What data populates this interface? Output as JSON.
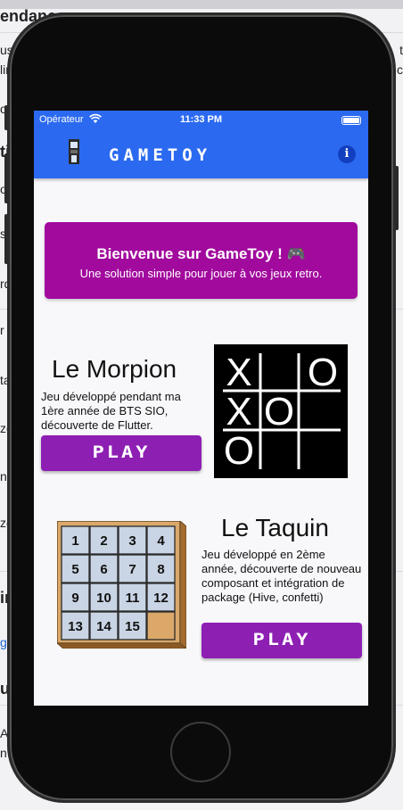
{
  "background": {
    "fragments": [
      "endances",
      "us",
      "lin",
      "o",
      "ti",
      "or",
      "s t",
      "rd",
      "r f",
      "ta",
      "ze",
      "no",
      "ze",
      "ir",
      "gi",
      "u",
      "Ax",
      "n"
    ],
    "right_fragments": [
      "t",
      "c"
    ]
  },
  "status_bar": {
    "carrier": "Opérateur",
    "time": "11:33 PM"
  },
  "app_bar": {
    "title": "GAMETOY"
  },
  "welcome": {
    "title": "Bienvenue sur GameToy ! 🎮",
    "subtitle": "Une solution simple pour jouer à vos jeux retro."
  },
  "games": [
    {
      "title": "Le Morpion",
      "description": "Jeu développé pendant ma 1ère année de BTS SIO, découverte de Flutter.",
      "play_label": "PLAY",
      "board": [
        "X",
        "",
        "O",
        "X",
        "O",
        "",
        "O",
        "",
        ""
      ]
    },
    {
      "title": "Le Taquin",
      "description": "Jeu développé en 2ème année, découverte de nouveau composant et intégration de package (Hive, confetti)",
      "play_label": "PLAY",
      "tiles": [
        "1",
        "2",
        "3",
        "4",
        "5",
        "6",
        "7",
        "8",
        "9",
        "10",
        "11",
        "12",
        "13",
        "14",
        "15",
        ""
      ]
    }
  ],
  "colors": {
    "app_bar": "#2b6af0",
    "welcome_card": "#a10a9d",
    "play_button": "#8e1fb3"
  }
}
